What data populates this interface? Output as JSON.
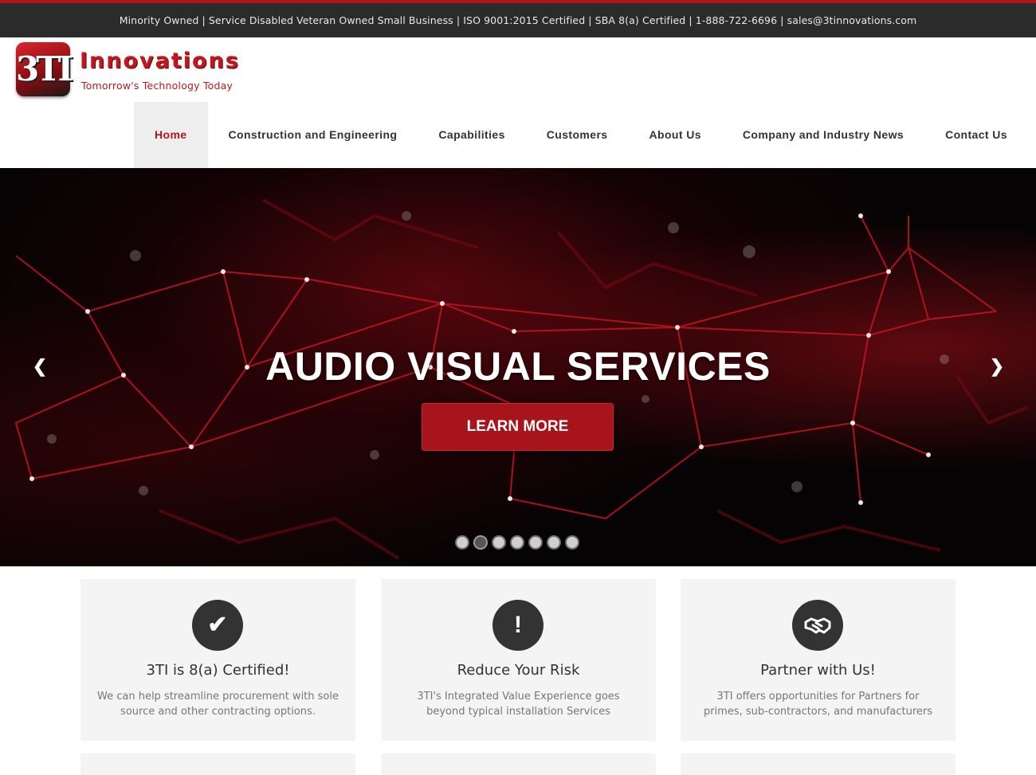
{
  "topbar": {
    "text": "Minority Owned | Service Disabled Veteran Owned Small Business | ISO 9001:2015 Certified  |  SBA 8(a) Certified | 1-888-722-6696 | sales@3tinnovations.com"
  },
  "logo": {
    "mark": "3TI",
    "name": "Innovations",
    "tagline": "Tomorrow's Technology Today"
  },
  "nav": {
    "items": [
      {
        "label": "Home",
        "active": true
      },
      {
        "label": "Construction and Engineering"
      },
      {
        "label": "Capabilities"
      },
      {
        "label": "Customers"
      },
      {
        "label": "About Us"
      },
      {
        "label": "Company and Industry News"
      },
      {
        "label": "Contact Us"
      }
    ]
  },
  "hero": {
    "title": "AUDIO VISUAL SERVICES",
    "button_label": "LEARN MORE",
    "prev_icon": "chevron-left-icon",
    "next_icon": "chevron-right-icon",
    "slide_count": 7,
    "active_slide": 2
  },
  "cards": [
    {
      "icon": "checkmark-icon",
      "glyph": "✔",
      "title": "3TI is 8(a) Certified!",
      "text": "We can help streamline procurement with sole source and other contracting options."
    },
    {
      "icon": "exclamation-icon",
      "glyph": "!",
      "title": "Reduce Your Risk",
      "text": "3TI's Integrated Value Experience goes beyond typical installation Services"
    },
    {
      "icon": "handshake-icon",
      "glyph": "🤝",
      "title": "Partner with Us!",
      "text": "3TI offers opportunities for Partners for primes, sub-contractors, and manufacturers"
    }
  ],
  "colors": {
    "brand_red": "#b3141b",
    "topbar_bg": "#2b2b2b",
    "card_bg": "#f4f4f4"
  }
}
